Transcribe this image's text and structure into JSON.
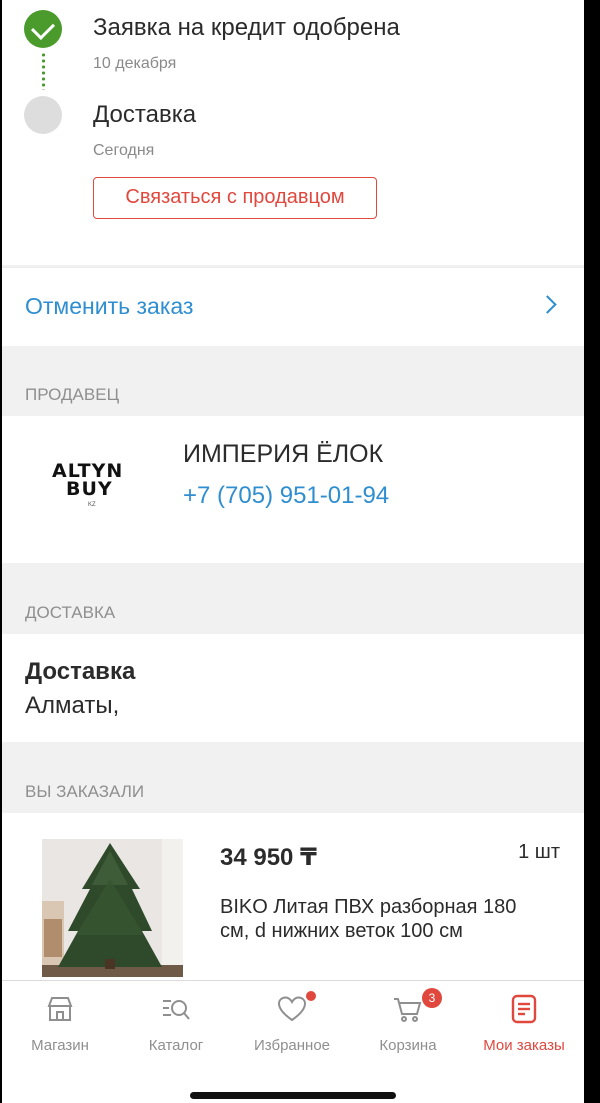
{
  "timeline": {
    "steps": [
      {
        "title": "Заявка на кредит одобрена",
        "date": "10 декабря",
        "status": "done"
      },
      {
        "title": "Доставка",
        "date": "Сегодня",
        "status": "pending"
      }
    ],
    "contact_button": "Связаться с продавцом"
  },
  "cancel": {
    "label": "Отменить заказ"
  },
  "seller": {
    "header": "ПРОДАВЕЦ",
    "logo": {
      "line1": "ALTYN",
      "line2": "BUY",
      "small": "KZ"
    },
    "name": "ИМПЕРИЯ ЁЛОК",
    "phone": "+7 (705) 951-01-94"
  },
  "delivery": {
    "header": "ДОСТАВКА",
    "title": "Доставка",
    "city": "Алматы,"
  },
  "order": {
    "header": "ВЫ ЗАКАЗАЛИ",
    "items": [
      {
        "price": "34 950 ₸",
        "qty": "1 шт",
        "name": "BIKO Литая ПВХ разборная 180 см, d нижних веток 100 см"
      }
    ]
  },
  "tabbar": {
    "tabs": [
      {
        "label": "Магазин",
        "icon": "store-icon"
      },
      {
        "label": "Каталог",
        "icon": "catalog-search-icon"
      },
      {
        "label": "Избранное",
        "icon": "heart-icon",
        "badge": "dot"
      },
      {
        "label": "Корзина",
        "icon": "cart-icon",
        "badge": "3"
      },
      {
        "label": "Мои заказы",
        "icon": "orders-icon",
        "active": true
      }
    ]
  },
  "colors": {
    "accent_red": "#e0483e",
    "link_blue": "#2f8ed0",
    "success_green": "#4a9a2c"
  }
}
